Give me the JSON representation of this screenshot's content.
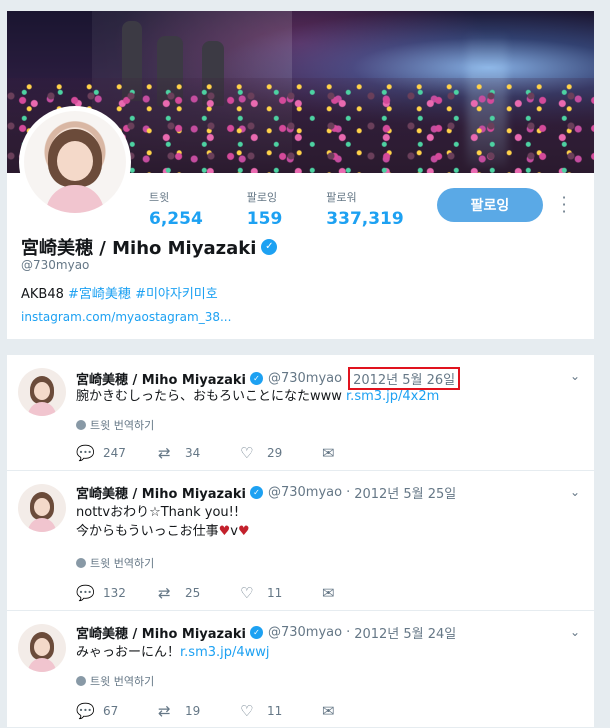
{
  "profile": {
    "stats": [
      {
        "label": "트윗",
        "value": "6,254"
      },
      {
        "label": "팔로잉",
        "value": "159"
      },
      {
        "label": "팔로워",
        "value": "337,319"
      }
    ],
    "follow_label": "팔로잉",
    "name": "宮崎美穂 / Miho Miyazaki",
    "handle": "@730myao",
    "bio": {
      "prefix": "AKB48 ",
      "tag1": "#宮崎美穂",
      "tag2": "#미야자키미호"
    },
    "link": "instagram.com/myaostagram_38..."
  },
  "translate_label": "트윗 번역하기",
  "tweets": [
    {
      "name": "宮崎美穂 / Miho Miyazaki",
      "handle": "@730myao",
      "date": "2012년 5월 26일",
      "text": "腕かきむしったら、おもろいことになたwww ",
      "link": "r.sm3.jp/4x2m",
      "replies": "247",
      "retweets": "34",
      "likes": "29"
    },
    {
      "name": "宮崎美穂 / Miho Miyazaki",
      "handle": "@730myao",
      "sep": "·",
      "date": "2012년 5월 25일",
      "line1": "nottvおわり☆Thank you!!",
      "line2a": "今からもういっこお仕事",
      "heart": "♥",
      "line2b": "v",
      "replies": "132",
      "retweets": "25",
      "likes": "11"
    },
    {
      "name": "宮崎美穂 / Miho Miyazaki",
      "handle": "@730myao",
      "sep": "·",
      "date": "2012년 5월 24일",
      "text": "みゃっおーにん！",
      "link": "r.sm3.jp/4wwj",
      "replies": "67",
      "retweets": "19",
      "likes": "11"
    }
  ],
  "accent_color": "#1da1f2",
  "highlight_color": "#e0131e"
}
